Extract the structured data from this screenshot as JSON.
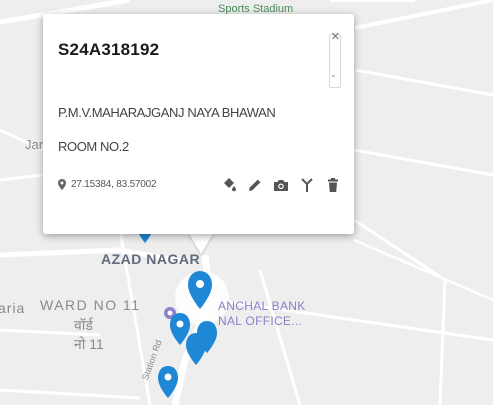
{
  "map": {
    "labels": {
      "stadium": "Sports Stadium",
      "place_left": "Jar",
      "azad_nagar": "AZAD NAGAR",
      "ward_left": "aria",
      "ward_en": "WARD NO 11",
      "ward_hi_1": "वॉर्ड",
      "ward_hi_2": "नो 11",
      "bank_line1": "ANCHAL BANK",
      "bank_line2": "NAL OFFICE...",
      "road": "Station Rd"
    },
    "colors": {
      "background": "#eeeeee",
      "road": "#ffffff",
      "marker": "#1e88d6",
      "label": "#8a8a8a",
      "azad_label": "#5f6b7a",
      "poi_icon": "#8b7fc9",
      "stadium_label": "#4d8b5a"
    }
  },
  "popup": {
    "title": "S24A318192",
    "address": "P.M.V.MAHARAJGANJ NAYA BHAWAN ROOM NO.2",
    "coordinates": "27.15384, 83.57002",
    "close_symbol": "×",
    "scroll_symbol": "⌄",
    "icons": {
      "location": "location-pin-icon",
      "paint": "paint-bucket-icon",
      "edit": "pencil-icon",
      "photo": "camera-icon",
      "signal": "antenna-icon",
      "delete": "trash-icon"
    }
  }
}
